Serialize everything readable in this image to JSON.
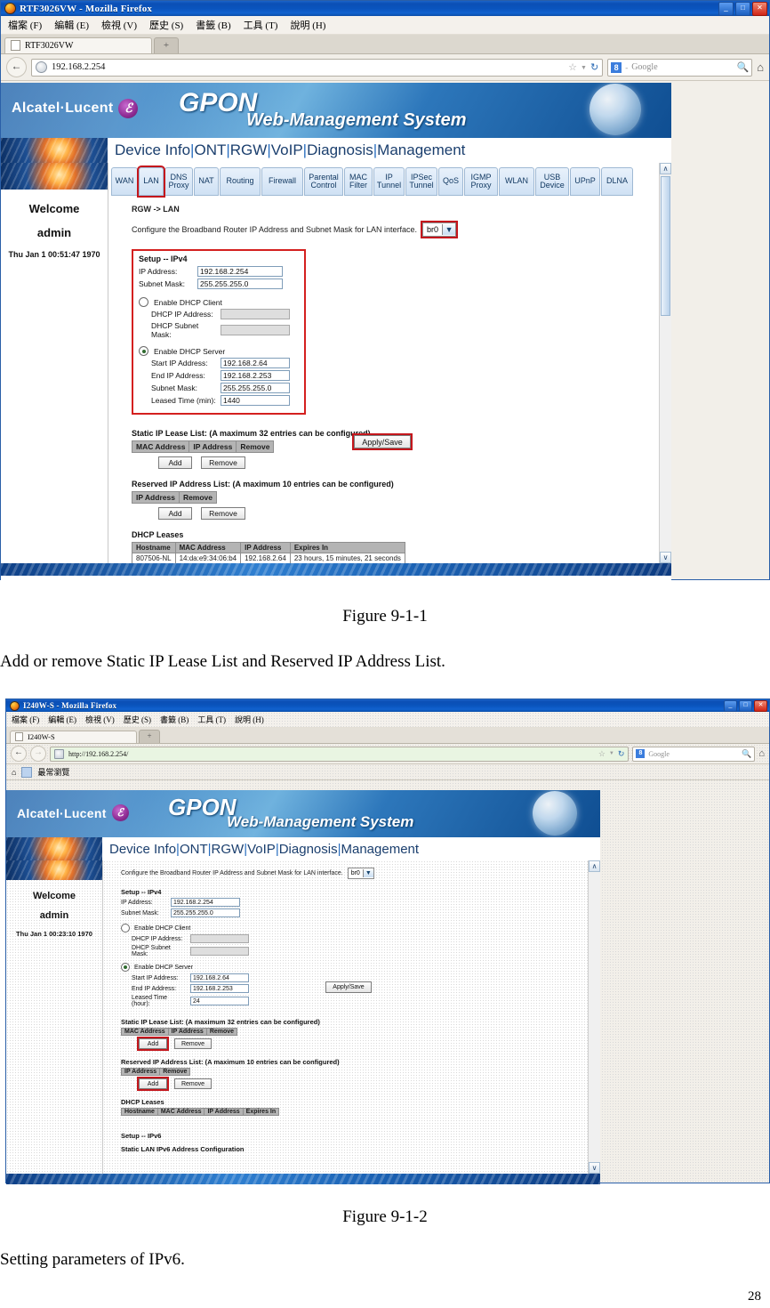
{
  "document": {
    "figure1_caption": "Figure 9-1-1",
    "paragraph1": "Add or remove Static IP Lease List and Reserved IP Address List.",
    "figure2_caption": "Figure 9-1-2",
    "paragraph2": "Setting parameters of IPv6.",
    "page_number": "28"
  },
  "window1": {
    "title": "RTF3026VW - Mozilla Firefox",
    "menu": [
      "檔案 (F)",
      "編輯 (E)",
      "檢視 (V)",
      "歷史 (S)",
      "書籤 (B)",
      "工具 (T)",
      "說明 (H)"
    ],
    "tab_label": "RTF3026VW",
    "new_tab_label": "+",
    "url": "192.168.2.254",
    "search_placeholder": "Google",
    "back_label": "←",
    "reload_label": "↻",
    "star_label": "☆",
    "dropdown_label": "▼",
    "home_label": "⌂",
    "min_label": "_",
    "max_label": "□",
    "close_label": "✕"
  },
  "window2": {
    "title": "I240W-S - Mozilla Firefox",
    "menu": [
      "檔案 (F)",
      "編輯 (E)",
      "檢視 (V)",
      "歷史 (S)",
      "書籤 (B)",
      "工具 (T)",
      "說明 (H)"
    ],
    "tab_label": "I240W-S",
    "new_tab_label": "+",
    "url": "http://192.168.2.254/",
    "search_placeholder": "Google",
    "bookmark_label": "最常瀏覽",
    "back_label": "←",
    "forward_label": "→",
    "reload_label": "↻",
    "star_label": "☆",
    "dropdown_label": "▼",
    "home_label": "⌂",
    "min_label": "_",
    "max_label": "□",
    "close_label": "✕"
  },
  "gpon": {
    "brand": "Alcatel·Lucent",
    "brand_mark": "ℰ",
    "product": "GPON",
    "subtitle": "Web-Management System",
    "nav": [
      "Device Info",
      "ONT",
      "RGW",
      "VoIP",
      "Diagnosis",
      "Management"
    ],
    "nav_separator": "|",
    "sidebar": {
      "welcome": "Welcome",
      "user": "admin",
      "datetime_1": "Thu Jan 1 00:51:47 1970",
      "datetime_2": "Thu Jan 1 00:23:10 1970"
    },
    "tabs": [
      {
        "line1": "WAN",
        "line2": ""
      },
      {
        "line1": "LAN",
        "line2": ""
      },
      {
        "line1": "DNS",
        "line2": "Proxy"
      },
      {
        "line1": "NAT",
        "line2": ""
      },
      {
        "line1": "Routing",
        "line2": ""
      },
      {
        "line1": "Firewall",
        "line2": ""
      },
      {
        "line1": "Parental",
        "line2": "Control"
      },
      {
        "line1": "MAC",
        "line2": "Filter"
      },
      {
        "line1": "IP",
        "line2": "Tunnel"
      },
      {
        "line1": "IPSec",
        "line2": "Tunnel"
      },
      {
        "line1": "QoS",
        "line2": ""
      },
      {
        "line1": "IGMP",
        "line2": "Proxy"
      },
      {
        "line1": "WLAN",
        "line2": ""
      },
      {
        "line1": "USB",
        "line2": "Device"
      },
      {
        "line1": "UPnP",
        "line2": ""
      },
      {
        "line1": "DLNA",
        "line2": ""
      }
    ],
    "selected_tab": "LAN",
    "breadcrumb": "RGW -> LAN",
    "interface_desc": "Configure the Broadband Router IP Address and Subnet Mask for LAN interface.",
    "interface_value": "br0",
    "setup_ipv4": {
      "legend": "Setup -- IPv4",
      "ip_address_label": "IP Address:",
      "ip_address_value": "192.168.2.254",
      "subnet_mask_label": "Subnet Mask:",
      "subnet_mask_value": "255.255.255.0",
      "dhcp_client_label": "Enable DHCP Client",
      "dhcp_client_ip_label": "DHCP IP Address:",
      "dhcp_client_ip_value": "",
      "dhcp_client_mask_label": "DHCP Subnet Mask:",
      "dhcp_client_mask_value": "",
      "dhcp_server_label": "Enable DHCP Server",
      "start_ip_label": "Start IP Address:",
      "start_ip_value": "192.168.2.64",
      "end_ip_label": "End IP Address:",
      "end_ip_value": "192.168.2.253",
      "server_mask_label": "Subnet Mask:",
      "server_mask_value": "255.255.255.0",
      "lease_min_label": "Leased Time (min):",
      "lease_min_value": "1440",
      "lease_hour_label": "Leased Time (hour):",
      "lease_hour_value": "24"
    },
    "apply_save_label": "Apply/Save",
    "static_lease": {
      "title": "Static IP Lease List: (A maximum 32 entries can be configured)",
      "headers": [
        "MAC Address",
        "IP Address",
        "Remove"
      ],
      "add_label": "Add",
      "remove_label": "Remove"
    },
    "reserved_ip": {
      "title": "Reserved IP Address List: (A maximum 10 entries can be configured)",
      "headers": [
        "IP Address",
        "Remove"
      ],
      "add_label": "Add",
      "remove_label": "Remove"
    },
    "dhcp_leases": {
      "title": "DHCP Leases",
      "headers": [
        "Hostname",
        "MAC Address",
        "IP Address",
        "Expires In"
      ],
      "rows": [
        [
          "807506-NL",
          "14:da:e9:34:06:b4",
          "192.168.2.64",
          "23 hours, 15 minutes, 21 seconds"
        ]
      ]
    },
    "setup_ipv6_title": "Setup -- IPv6",
    "static_lan_ipv6_title": "Static LAN IPv6 Address Configuration",
    "scroll_up": "∧",
    "scroll_down": "∨"
  },
  "colors": {
    "accent_blue": "#0b4fb5",
    "highlight_red": "#c4161c",
    "banner_blue": "#2f7ec2",
    "table_header_gray": "#b4b4b4"
  }
}
